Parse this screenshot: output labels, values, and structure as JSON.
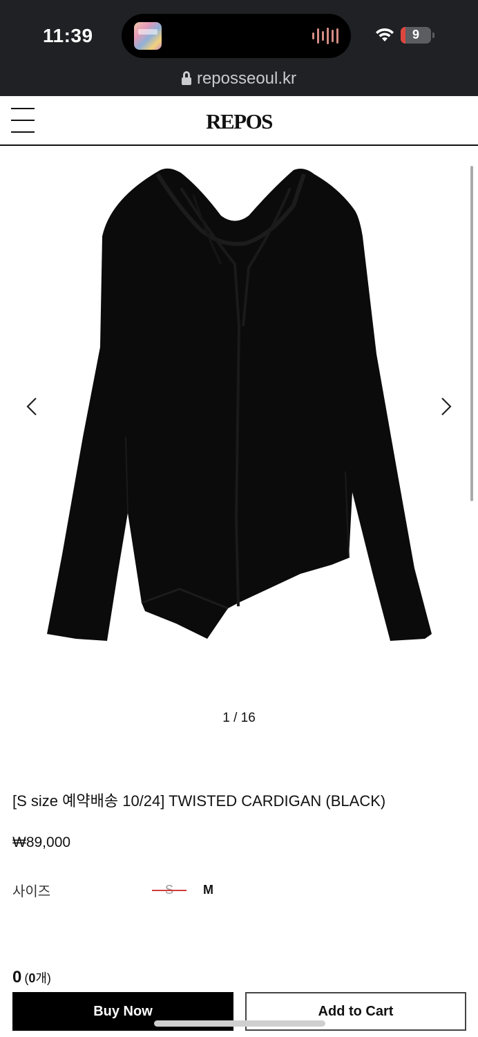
{
  "status_bar": {
    "time": "11:39",
    "battery": "9",
    "battery_color": "#e0463e"
  },
  "browser": {
    "url": "reposseoul.kr"
  },
  "header": {
    "logo": "REPOS"
  },
  "gallery": {
    "counter": "1 / 16",
    "image_icon": "cardigan-image"
  },
  "product": {
    "title": "[S size 예약배송 10/24] TWISTED CARDIGAN (BLACK)",
    "price": "₩89,000",
    "size_label": "사이즈",
    "sizes": [
      {
        "label": "S",
        "sold_out": true
      },
      {
        "label": "M",
        "sold_out": false
      }
    ]
  },
  "summary": {
    "total": "0",
    "count_open": "(",
    "count_value": "0",
    "count_unit": "개)"
  },
  "actions": {
    "buy_now": "Buy Now",
    "add_to_cart": "Add to Cart"
  }
}
